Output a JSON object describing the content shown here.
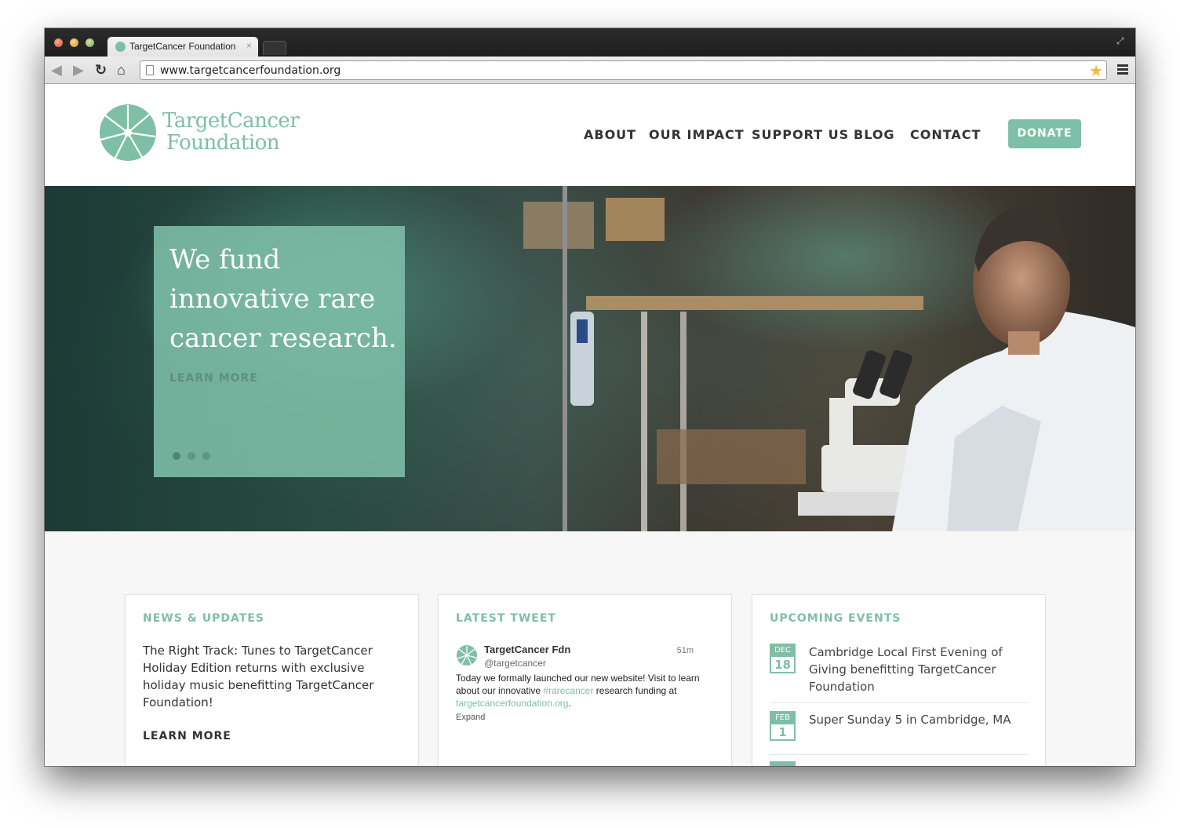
{
  "browser": {
    "tab_title": "TargetCancer Foundation",
    "tab_close": "×",
    "url": "www.targetcancerfoundation.org",
    "icons": [
      "back-arrow-icon",
      "forward-arrow-icon",
      "reload-icon",
      "home-icon",
      "page-icon",
      "star-icon",
      "menu-icon"
    ]
  },
  "site": {
    "logo": {
      "line1": "TargetCancer",
      "line2": "Foundation"
    },
    "nav": [
      "ABOUT",
      "OUR IMPACT",
      "SUPPORT US",
      "BLOG",
      "CONTACT"
    ],
    "donate": "DONATE",
    "hero": {
      "headline": "We fund innovative rare cancer research.",
      "cta": "LEARN MORE",
      "slides": 3,
      "active_slide": 1
    },
    "news": {
      "title": "NEWS & UPDATES",
      "body": "The Right Track: Tunes to TargetCancer Holiday Edition returns with exclusive holiday music benefitting TargetCancer Foundation!",
      "cta": "LEARN MORE"
    },
    "tweet": {
      "title": "LATEST TWEET",
      "name": "TargetCancer Fdn",
      "handle": "@targetcancer",
      "time": "51m",
      "text_before": "Today we formally launched our new website! Visit to learn about our innovative ",
      "hashtag": "#rarecancer",
      "text_middle": " research funding at ",
      "link": "targetcancerfoundation.org",
      "text_after": ".",
      "expand": "Expand"
    },
    "events": {
      "title": "UPCOMING EVENTS",
      "items": [
        {
          "month": "DEC",
          "day": "18",
          "text": "Cambridge Local First Evening of Giving benefitting TargetCancer Foundation"
        },
        {
          "month": "FEB",
          "day": "1",
          "text": "Super Sunday 5 in Cambridge, MA"
        }
      ]
    },
    "colors": {
      "brand": "#7ebfa8",
      "text": "#333333"
    }
  }
}
